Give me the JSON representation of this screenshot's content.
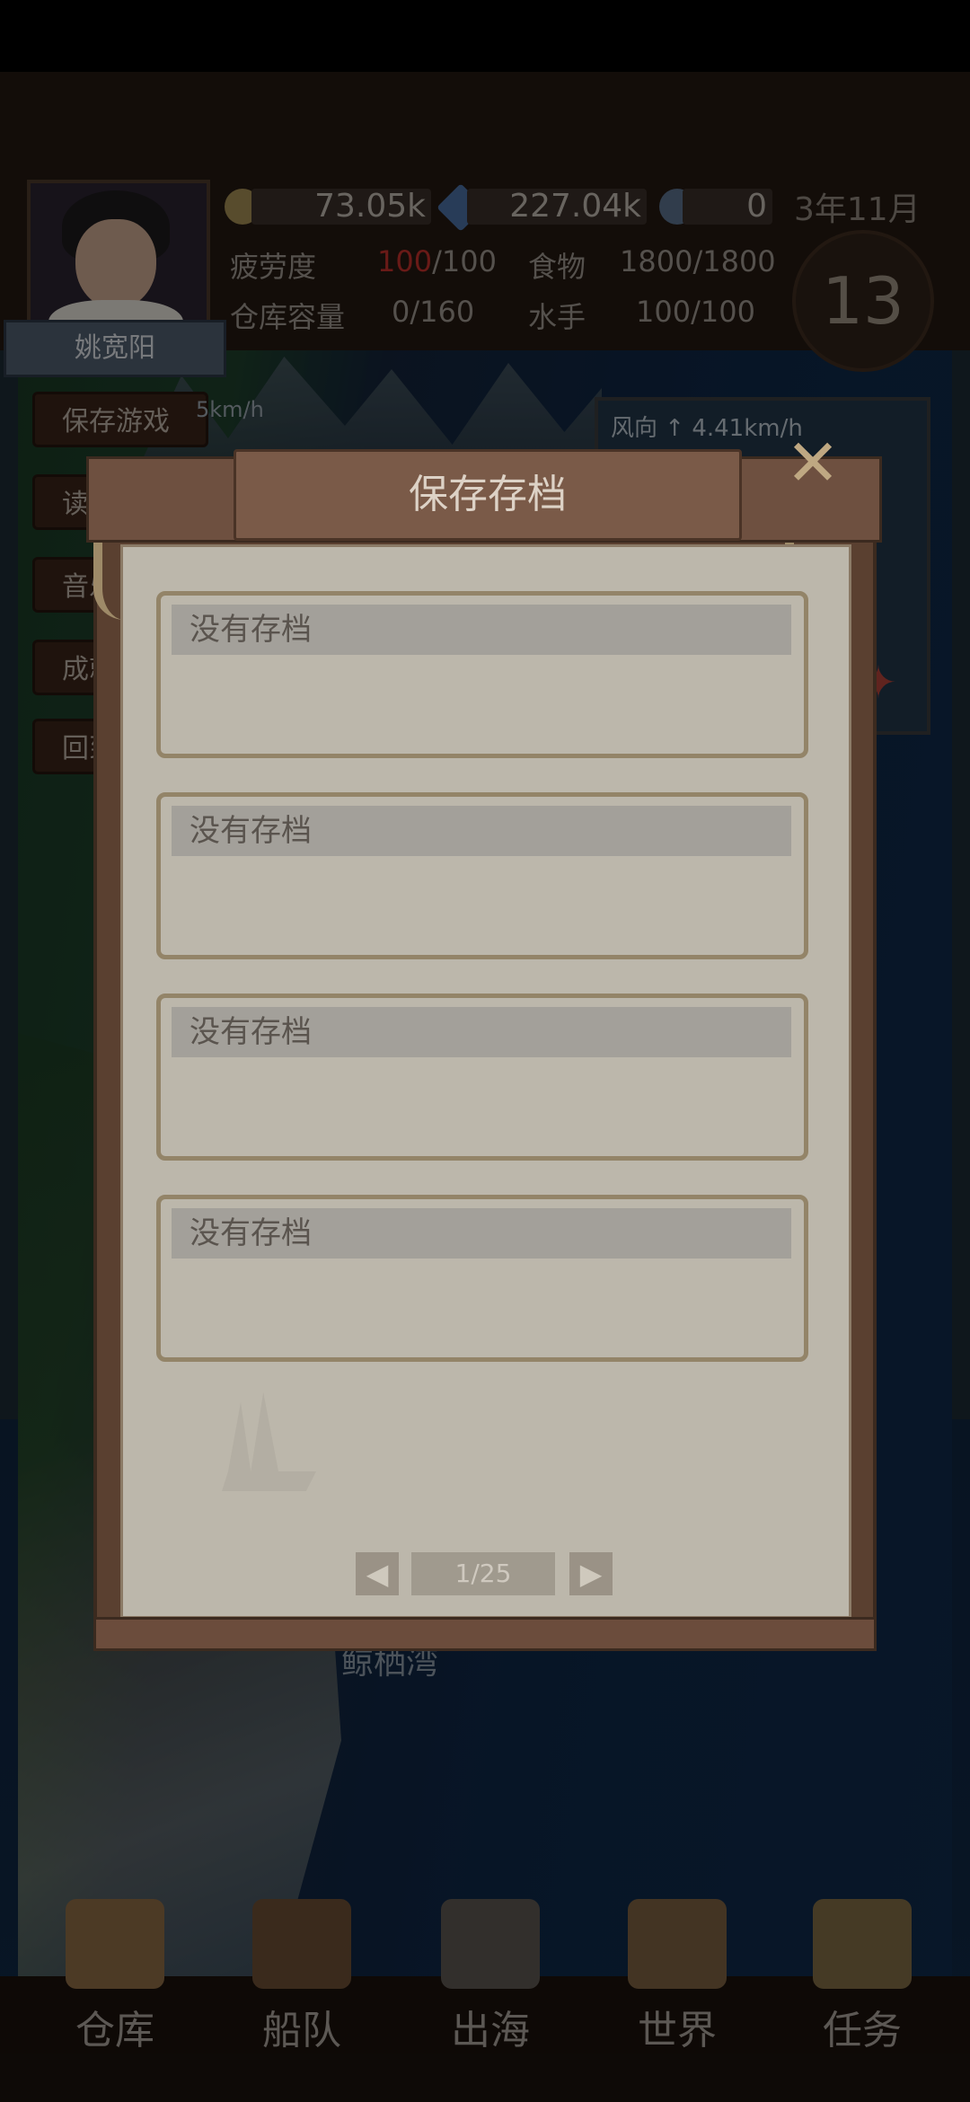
{
  "player": {
    "name": "姚宽阳"
  },
  "resources": {
    "gold": "73.05k",
    "gems": "227.04k",
    "tokens": "0"
  },
  "date": "3年11月",
  "day": "13",
  "stats": {
    "fatigue_label": "疲劳度",
    "fatigue_current": "100",
    "fatigue_max": "/100",
    "food_label": "食物",
    "food_value": "1800/1800",
    "storage_label": "仓库容量",
    "storage_value": "0/160",
    "sailors_label": "水手",
    "sailors_value": "100/100"
  },
  "side_menu": [
    {
      "label": "保存游戏"
    },
    {
      "label": "读取游戏"
    },
    {
      "label": "音乐"
    },
    {
      "label": "成就"
    },
    {
      "label": "回到"
    }
  ],
  "speed_text": "5km/h",
  "wind": {
    "label": "风向 ↑ 4.41km/h"
  },
  "place_label": "鲸栖湾",
  "dialog": {
    "title": "保存存档",
    "slots": [
      {
        "label": "没有存档"
      },
      {
        "label": "没有存档"
      },
      {
        "label": "没有存档"
      },
      {
        "label": "没有存档"
      }
    ],
    "page": "1/25"
  },
  "nav": [
    {
      "label": "仓库",
      "icon": "warehouse-bag-icon"
    },
    {
      "label": "船队",
      "icon": "fleet-anchor-shield-icon"
    },
    {
      "label": "出海",
      "icon": "ship-icon"
    },
    {
      "label": "世界",
      "icon": "world-map-compass-icon"
    },
    {
      "label": "任务",
      "icon": "quest-scroll-icon"
    }
  ],
  "colors": {
    "fatigue_accent": "#c0302a",
    "paper": "#bcb7ab",
    "wood": "#5a4030"
  }
}
